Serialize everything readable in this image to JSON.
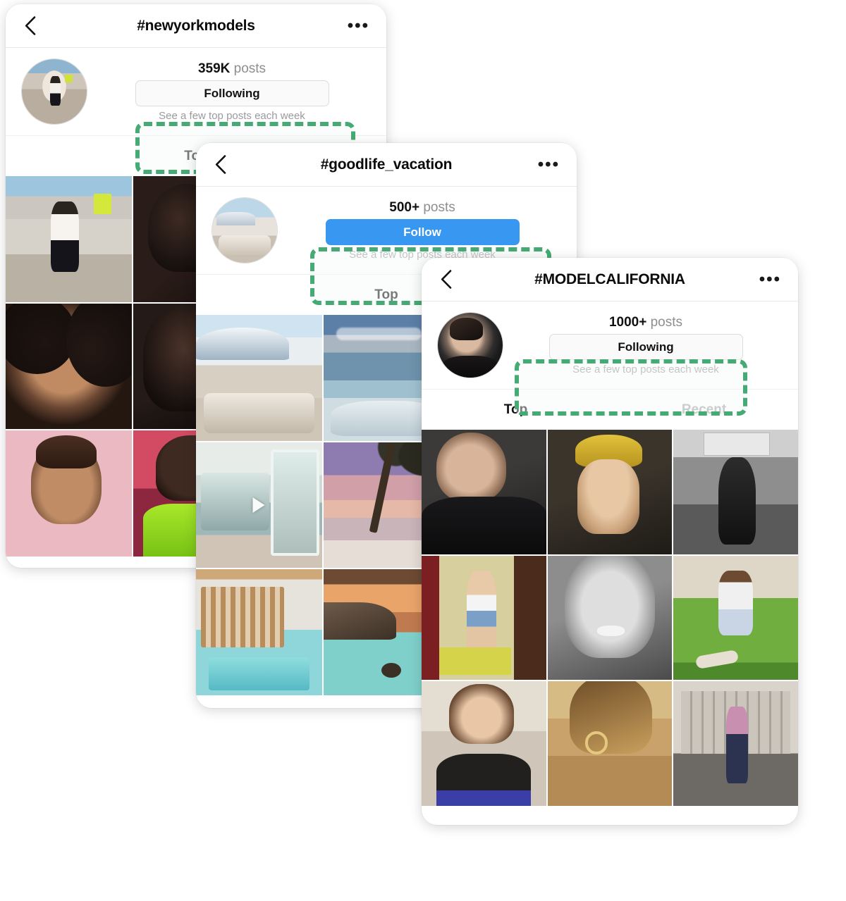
{
  "cards": [
    {
      "id": "card-1",
      "nav": {
        "back_icon": "chevron-left-icon",
        "title": "#newyorkmodels",
        "more_icon": "more-options-icon"
      },
      "profile": {
        "avatar_name": "hashtag-avatar",
        "posts_count": "359K",
        "posts_label": "posts",
        "button_label": "Following",
        "button_state": "following",
        "subnote": "See a few top posts each week"
      },
      "tabs": [
        {
          "label": "Top",
          "active": true
        }
      ],
      "grid_cells": [
        {
          "name": "post-thumbnail",
          "art": "g1a",
          "video": false
        },
        {
          "name": "post-thumbnail",
          "art": "g1b",
          "video": false
        },
        {
          "name": "post-thumbnail",
          "art": "g1c",
          "video": false
        },
        {
          "name": "post-thumbnail",
          "art": "g1d",
          "video": false
        },
        {
          "name": "post-thumbnail",
          "art": "g1e",
          "video": false
        },
        {
          "name": "post-thumbnail",
          "art": "g1f",
          "video": false
        }
      ]
    },
    {
      "id": "card-2",
      "nav": {
        "back_icon": "chevron-left-icon",
        "title": "#goodlife_vacation",
        "more_icon": "more-options-icon"
      },
      "profile": {
        "avatar_name": "hashtag-avatar",
        "posts_count": "500+",
        "posts_label": "posts",
        "button_label": "Follow",
        "button_state": "follow",
        "subnote": "See a few top posts each week"
      },
      "tabs": [
        {
          "label": "Top",
          "active": true
        }
      ],
      "grid_cells": [
        {
          "name": "post-thumbnail",
          "art": "g2a",
          "video": false
        },
        {
          "name": "post-thumbnail",
          "art": "g2b",
          "video": false
        },
        {
          "name": "post-thumbnail",
          "art": "g2c",
          "video": true
        },
        {
          "name": "post-thumbnail",
          "art": "g2d",
          "video": false
        },
        {
          "name": "post-thumbnail",
          "art": "g2e",
          "video": false
        },
        {
          "name": "post-thumbnail",
          "art": "g2f",
          "video": false
        }
      ]
    },
    {
      "id": "card-3",
      "nav": {
        "back_icon": "chevron-left-icon",
        "title": "#MODELCALIFORNIA",
        "more_icon": "more-options-icon"
      },
      "profile": {
        "avatar_name": "hashtag-avatar",
        "posts_count": "1000+",
        "posts_label": "posts",
        "button_label": "Following",
        "button_state": "following",
        "subnote": "See a few top posts each week"
      },
      "tabs": [
        {
          "label": "Top",
          "active": true
        },
        {
          "label": "Recent",
          "active": false
        }
      ],
      "grid_cells": [
        {
          "name": "post-thumbnail",
          "art": "g3a",
          "video": false
        },
        {
          "name": "post-thumbnail",
          "art": "g3b",
          "video": false
        },
        {
          "name": "post-thumbnail",
          "art": "g3c",
          "video": false
        },
        {
          "name": "post-thumbnail",
          "art": "g3d",
          "video": false
        },
        {
          "name": "post-thumbnail",
          "art": "g3e",
          "video": false
        },
        {
          "name": "post-thumbnail",
          "art": "g3f",
          "video": false
        },
        {
          "name": "post-thumbnail",
          "art": "g3g",
          "video": false
        },
        {
          "name": "post-thumbnail",
          "art": "g3h",
          "video": false
        },
        {
          "name": "post-thumbnail",
          "art": "g3i",
          "video": false
        }
      ]
    }
  ],
  "annotation": {
    "name": "green-dashed-highlight",
    "color": "#45aa73",
    "style": "dashed"
  }
}
